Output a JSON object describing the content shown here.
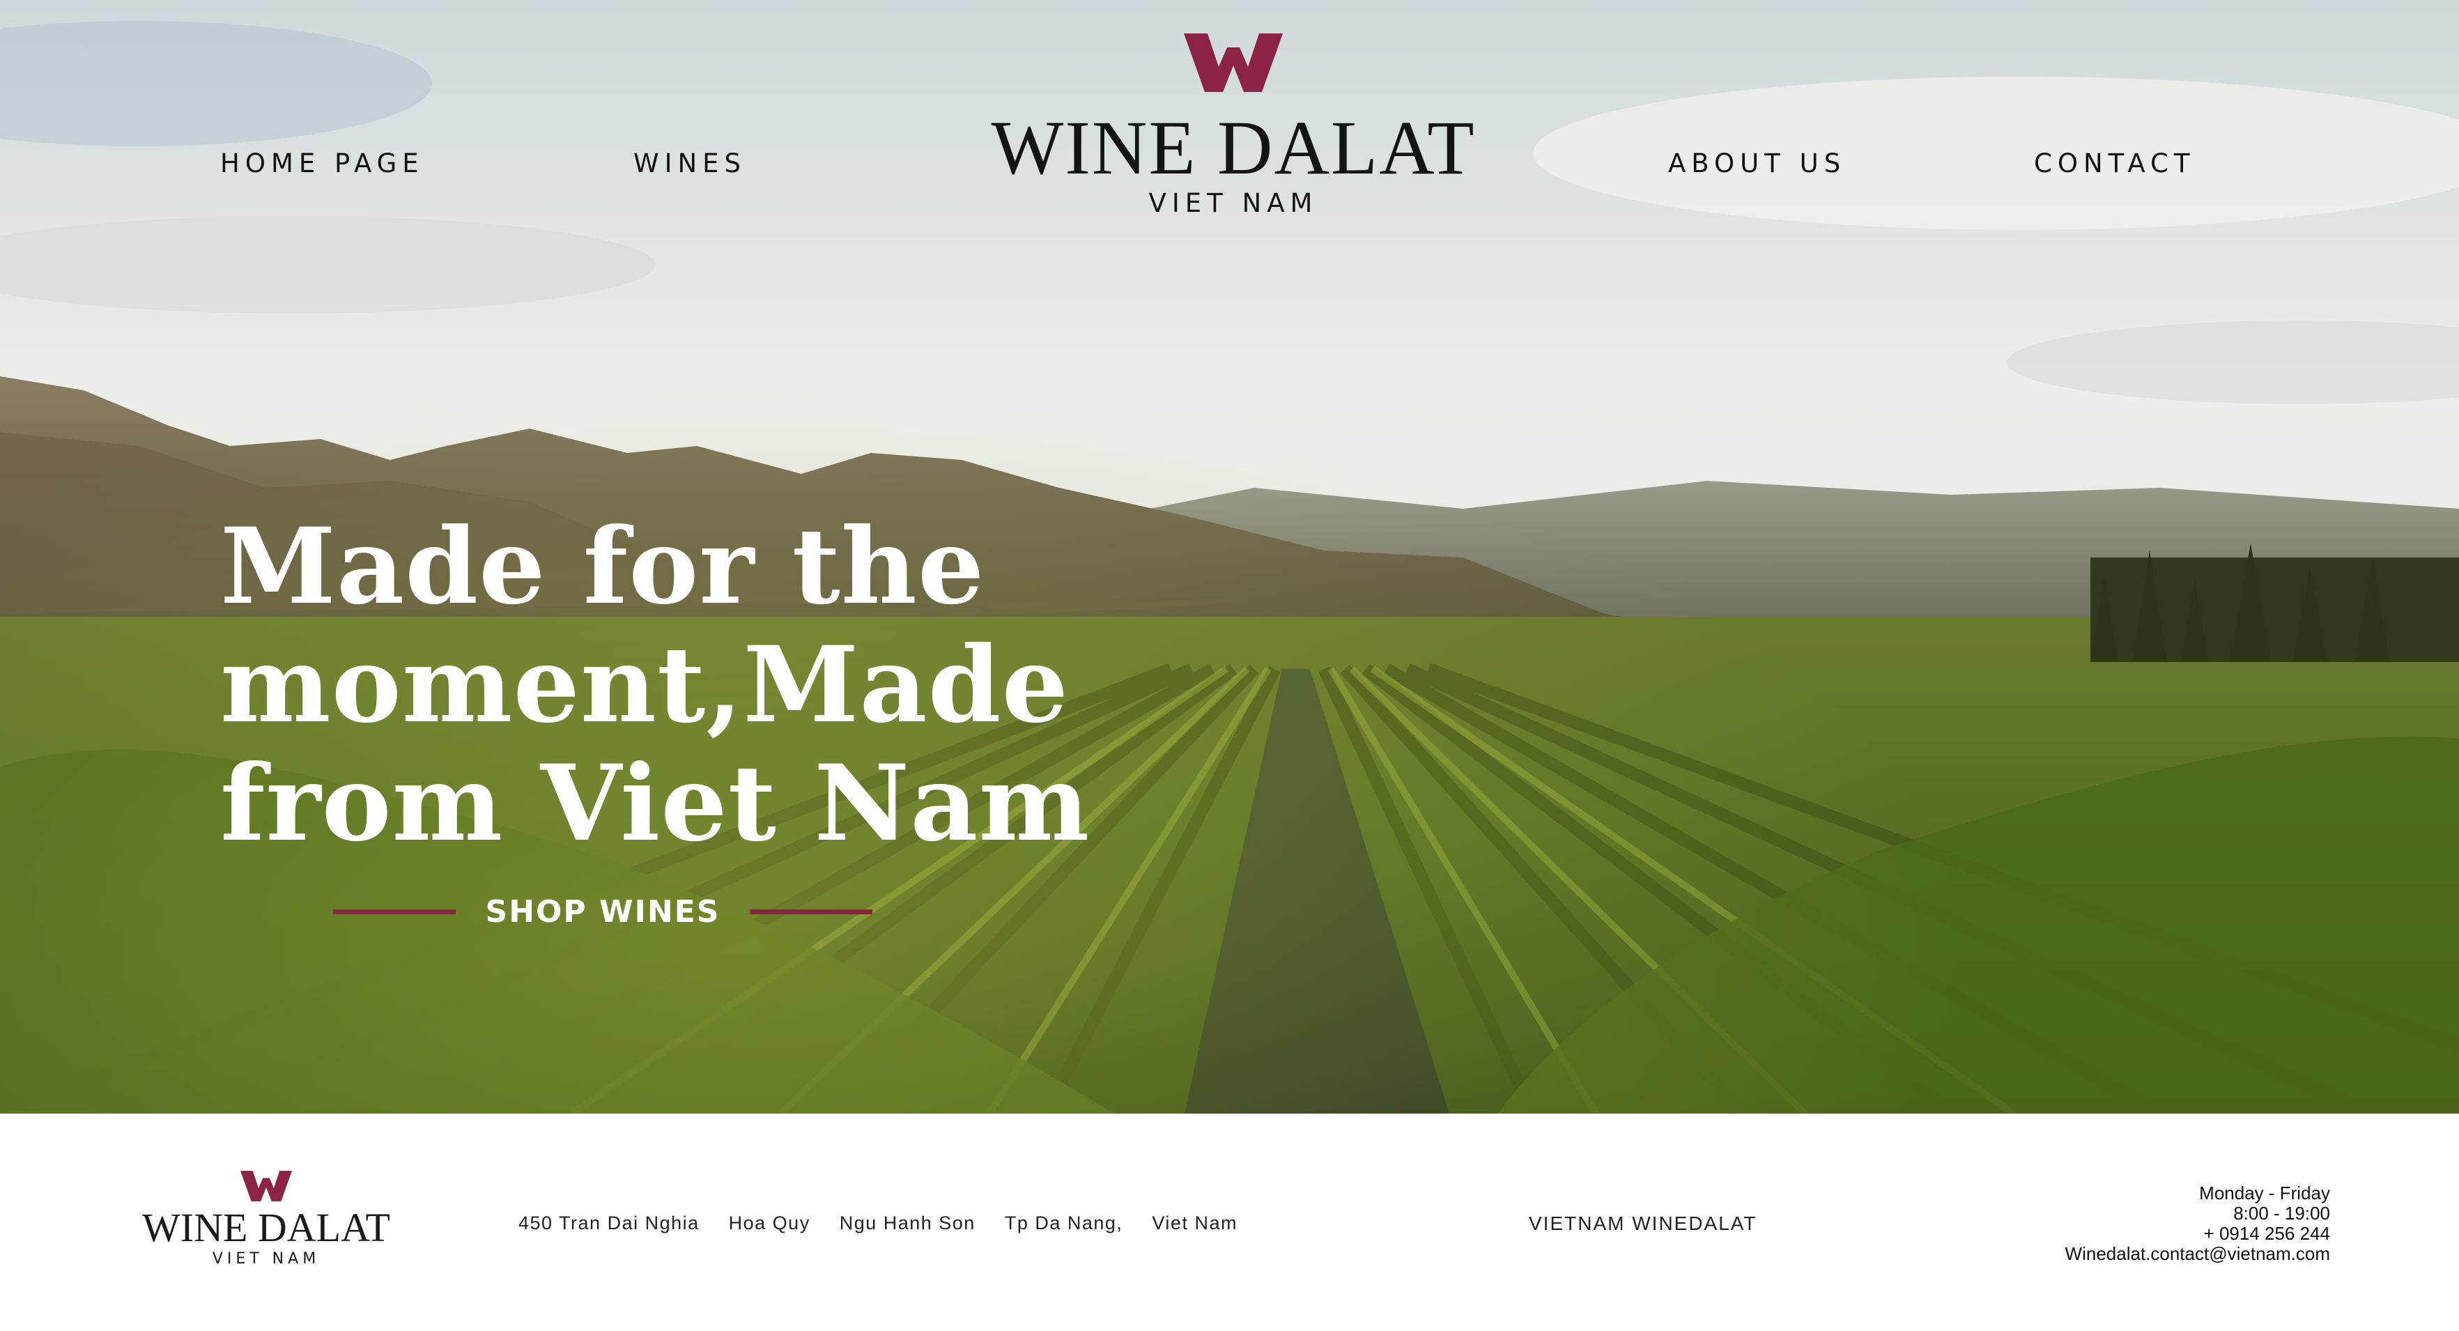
{
  "nav": {
    "home": "HOME PAGE",
    "wines": "WINES",
    "about": "ABOUT US",
    "contact": "CONTACT"
  },
  "brand": {
    "name": "WINE DALAT",
    "sub": "VIET NAM",
    "logo_icon": "w-logo-icon"
  },
  "hero": {
    "headline_lines": [
      "Made for the",
      "moment,Made",
      "from Viet Nam"
    ],
    "cta_label": "SHOP WINES"
  },
  "footer": {
    "address_parts": [
      "450 Tran Dai Nghia",
      "Hoa Quy",
      "Ngu Hanh Son",
      "Tp Da Nang,",
      "Viet Nam"
    ],
    "company": "VIETNAM WINEDALAT",
    "hours_days": "Monday - Friday",
    "hours_time": "8:00 - 19:00",
    "phone": "+ 0914 256 244",
    "email": "Winedalat.contact@vietnam.com"
  },
  "colors": {
    "accent": "#8a2344",
    "text_dark": "#111111",
    "hero_text": "#ffffff"
  }
}
